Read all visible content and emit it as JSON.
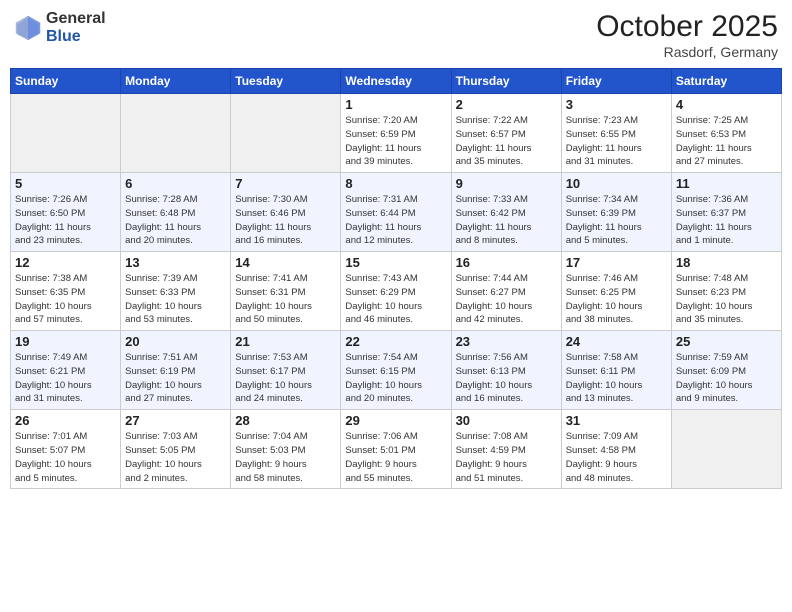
{
  "header": {
    "logo_general": "General",
    "logo_blue": "Blue",
    "month_title": "October 2025",
    "location": "Rasdorf, Germany"
  },
  "weekdays": [
    "Sunday",
    "Monday",
    "Tuesday",
    "Wednesday",
    "Thursday",
    "Friday",
    "Saturday"
  ],
  "weeks": [
    [
      {
        "day": "",
        "info": ""
      },
      {
        "day": "",
        "info": ""
      },
      {
        "day": "",
        "info": ""
      },
      {
        "day": "1",
        "info": "Sunrise: 7:20 AM\nSunset: 6:59 PM\nDaylight: 11 hours\nand 39 minutes."
      },
      {
        "day": "2",
        "info": "Sunrise: 7:22 AM\nSunset: 6:57 PM\nDaylight: 11 hours\nand 35 minutes."
      },
      {
        "day": "3",
        "info": "Sunrise: 7:23 AM\nSunset: 6:55 PM\nDaylight: 11 hours\nand 31 minutes."
      },
      {
        "day": "4",
        "info": "Sunrise: 7:25 AM\nSunset: 6:53 PM\nDaylight: 11 hours\nand 27 minutes."
      }
    ],
    [
      {
        "day": "5",
        "info": "Sunrise: 7:26 AM\nSunset: 6:50 PM\nDaylight: 11 hours\nand 23 minutes."
      },
      {
        "day": "6",
        "info": "Sunrise: 7:28 AM\nSunset: 6:48 PM\nDaylight: 11 hours\nand 20 minutes."
      },
      {
        "day": "7",
        "info": "Sunrise: 7:30 AM\nSunset: 6:46 PM\nDaylight: 11 hours\nand 16 minutes."
      },
      {
        "day": "8",
        "info": "Sunrise: 7:31 AM\nSunset: 6:44 PM\nDaylight: 11 hours\nand 12 minutes."
      },
      {
        "day": "9",
        "info": "Sunrise: 7:33 AM\nSunset: 6:42 PM\nDaylight: 11 hours\nand 8 minutes."
      },
      {
        "day": "10",
        "info": "Sunrise: 7:34 AM\nSunset: 6:39 PM\nDaylight: 11 hours\nand 5 minutes."
      },
      {
        "day": "11",
        "info": "Sunrise: 7:36 AM\nSunset: 6:37 PM\nDaylight: 11 hours\nand 1 minute."
      }
    ],
    [
      {
        "day": "12",
        "info": "Sunrise: 7:38 AM\nSunset: 6:35 PM\nDaylight: 10 hours\nand 57 minutes."
      },
      {
        "day": "13",
        "info": "Sunrise: 7:39 AM\nSunset: 6:33 PM\nDaylight: 10 hours\nand 53 minutes."
      },
      {
        "day": "14",
        "info": "Sunrise: 7:41 AM\nSunset: 6:31 PM\nDaylight: 10 hours\nand 50 minutes."
      },
      {
        "day": "15",
        "info": "Sunrise: 7:43 AM\nSunset: 6:29 PM\nDaylight: 10 hours\nand 46 minutes."
      },
      {
        "day": "16",
        "info": "Sunrise: 7:44 AM\nSunset: 6:27 PM\nDaylight: 10 hours\nand 42 minutes."
      },
      {
        "day": "17",
        "info": "Sunrise: 7:46 AM\nSunset: 6:25 PM\nDaylight: 10 hours\nand 38 minutes."
      },
      {
        "day": "18",
        "info": "Sunrise: 7:48 AM\nSunset: 6:23 PM\nDaylight: 10 hours\nand 35 minutes."
      }
    ],
    [
      {
        "day": "19",
        "info": "Sunrise: 7:49 AM\nSunset: 6:21 PM\nDaylight: 10 hours\nand 31 minutes."
      },
      {
        "day": "20",
        "info": "Sunrise: 7:51 AM\nSunset: 6:19 PM\nDaylight: 10 hours\nand 27 minutes."
      },
      {
        "day": "21",
        "info": "Sunrise: 7:53 AM\nSunset: 6:17 PM\nDaylight: 10 hours\nand 24 minutes."
      },
      {
        "day": "22",
        "info": "Sunrise: 7:54 AM\nSunset: 6:15 PM\nDaylight: 10 hours\nand 20 minutes."
      },
      {
        "day": "23",
        "info": "Sunrise: 7:56 AM\nSunset: 6:13 PM\nDaylight: 10 hours\nand 16 minutes."
      },
      {
        "day": "24",
        "info": "Sunrise: 7:58 AM\nSunset: 6:11 PM\nDaylight: 10 hours\nand 13 minutes."
      },
      {
        "day": "25",
        "info": "Sunrise: 7:59 AM\nSunset: 6:09 PM\nDaylight: 10 hours\nand 9 minutes."
      }
    ],
    [
      {
        "day": "26",
        "info": "Sunrise: 7:01 AM\nSunset: 5:07 PM\nDaylight: 10 hours\nand 5 minutes."
      },
      {
        "day": "27",
        "info": "Sunrise: 7:03 AM\nSunset: 5:05 PM\nDaylight: 10 hours\nand 2 minutes."
      },
      {
        "day": "28",
        "info": "Sunrise: 7:04 AM\nSunset: 5:03 PM\nDaylight: 9 hours\nand 58 minutes."
      },
      {
        "day": "29",
        "info": "Sunrise: 7:06 AM\nSunset: 5:01 PM\nDaylight: 9 hours\nand 55 minutes."
      },
      {
        "day": "30",
        "info": "Sunrise: 7:08 AM\nSunset: 4:59 PM\nDaylight: 9 hours\nand 51 minutes."
      },
      {
        "day": "31",
        "info": "Sunrise: 7:09 AM\nSunset: 4:58 PM\nDaylight: 9 hours\nand 48 minutes."
      },
      {
        "day": "",
        "info": ""
      }
    ]
  ]
}
